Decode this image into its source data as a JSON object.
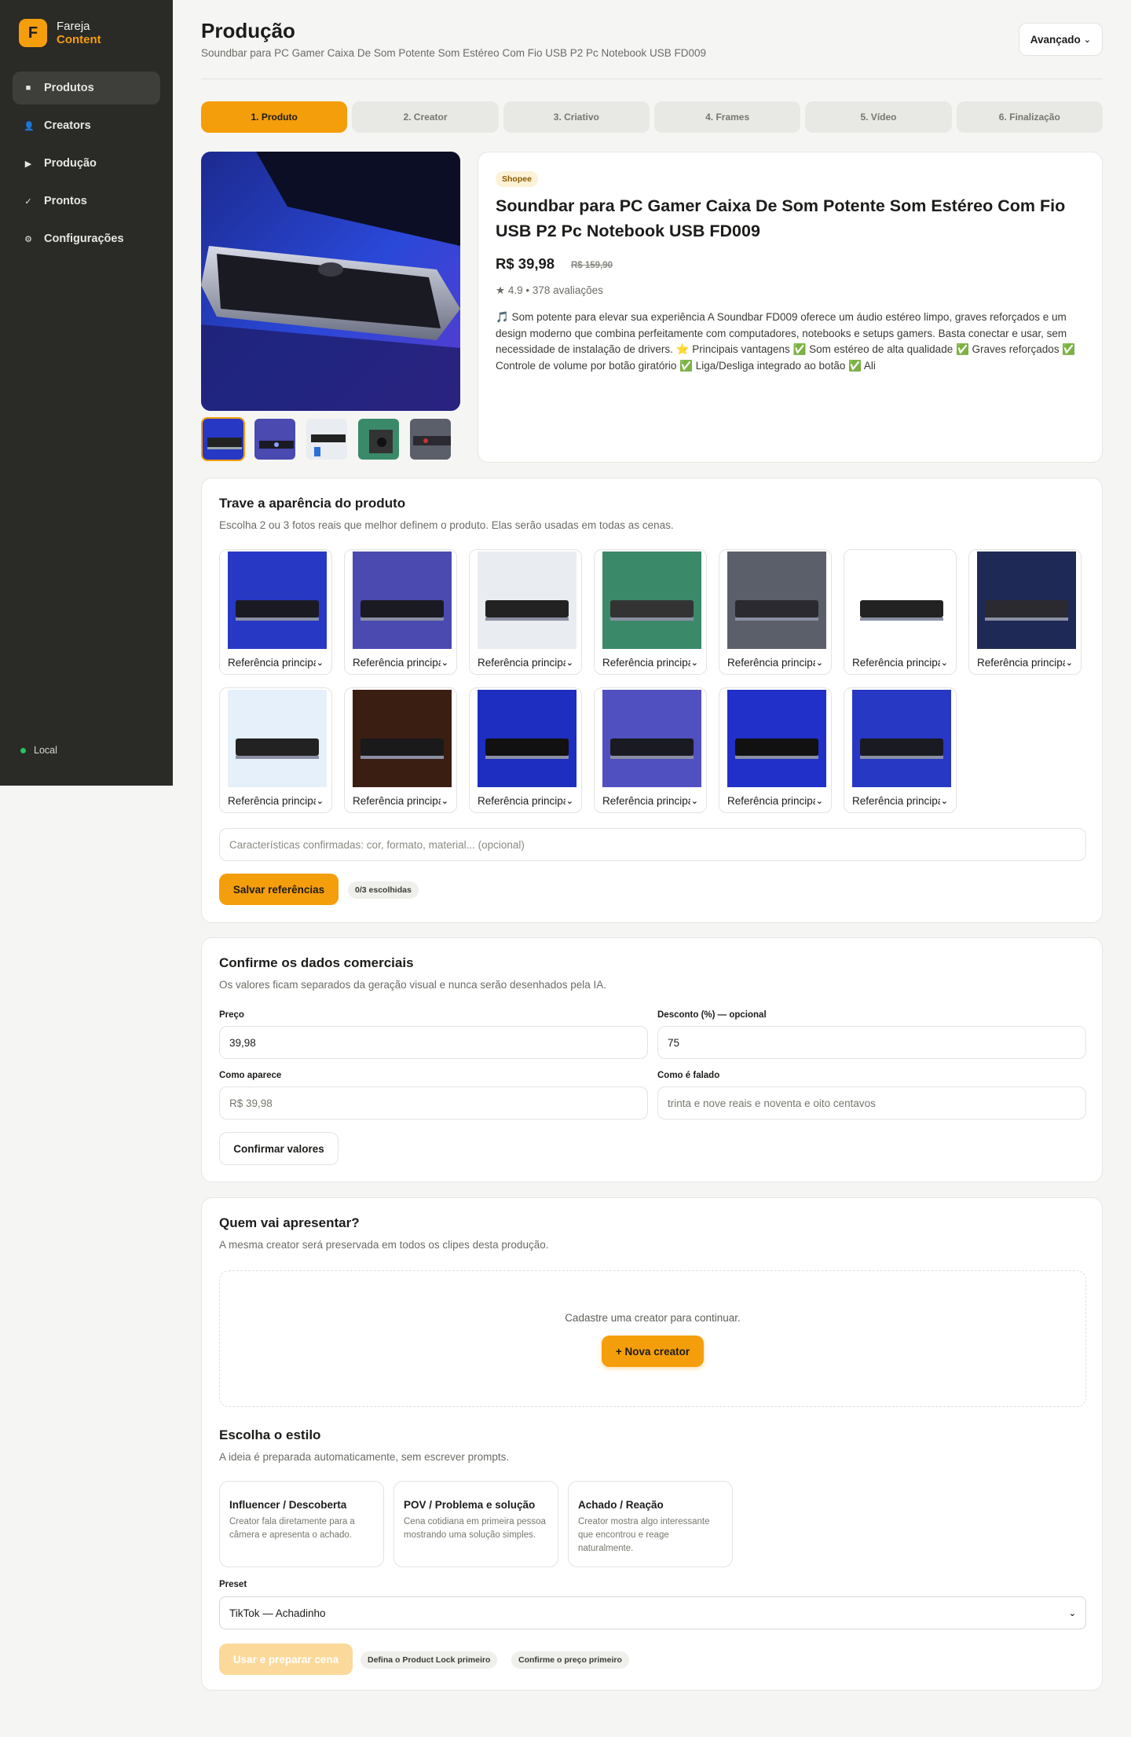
{
  "sidebar": {
    "brand_initial": "F",
    "brand_line1": "Fareja",
    "brand_line2": "Content",
    "items": [
      {
        "label": "Produtos",
        "icon": "square-icon"
      },
      {
        "label": "Creators",
        "icon": "person-icon"
      },
      {
        "label": "Produção",
        "icon": "play-icon"
      },
      {
        "label": "Prontos",
        "icon": "check-icon"
      },
      {
        "label": "Configurações",
        "icon": "gear-icon"
      }
    ],
    "status": "Local"
  },
  "header": {
    "title": "Produção",
    "subtitle": "Soundbar para PC Gamer Caixa De Som Potente Som Estéreo Com Fio USB P2 Pc Notebook USB FD009",
    "advanced_label": "Avançado",
    "advanced_chevron": "⌄"
  },
  "steps": [
    "1. Produto",
    "2. Creator",
    "3. Criativo",
    "4. Frames",
    "5. Vídeo",
    "6. Finalização"
  ],
  "product": {
    "source": "Shopee",
    "title": "Soundbar para PC Gamer Caixa De Som Potente Som Estéreo Com Fio USB P2 Pc Notebook USB FD009",
    "price": "R$ 39,98",
    "old_price": "R$ 159,90",
    "rating": "★ 4.9 • 378 avaliações",
    "description": "🎵 Som potente para elevar sua experiência A Soundbar FD009 oferece um áudio estéreo limpo, graves reforçados e um design moderno que combina perfeitamente com computadores, notebooks e setups gamers. Basta conectar e usar, sem necessidade de instalação de drivers. ⭐ Principais vantagens ✅ Som estéreo de alta qualidade ✅ Graves reforçados ✅ Controle de volume por botão giratório ✅ Liga/Desliga integrado ao botão ✅ Ali"
  },
  "lock": {
    "title": "Trave a aparência do produto",
    "subtitle": "Escolha 2 ou 3 fotos reais que melhor definem o produto. Elas serão usadas em todas as cenas.",
    "ref_label": "Referência principal",
    "ref_count": 13,
    "features_placeholder": "Características confirmadas: cor, formato, material... (opcional)",
    "save_label": "Salvar referências",
    "chosen": "0/3 escolhidas"
  },
  "commercial": {
    "title": "Confirme os dados comerciais",
    "subtitle": "Os valores ficam separados da geração visual e nunca serão desenhados pela IA.",
    "price_label": "Preço",
    "price_value": "39,98",
    "discount_label": "Desconto (%) — opcional",
    "discount_value": "75",
    "display_label": "Como aparece",
    "display_placeholder": "R$ 39,98",
    "spoken_label": "Como é falado",
    "spoken_placeholder": "trinta e nove reais e noventa e oito centavos",
    "confirm_label": "Confirmar valores"
  },
  "creator": {
    "title": "Quem vai apresentar?",
    "subtitle": "A mesma creator será preservada em todos os clipes desta produção.",
    "empty_text": "Cadastre uma creator para continuar.",
    "new_label": "+ Nova creator"
  },
  "style": {
    "title": "Escolha o estilo",
    "subtitle": "A ideia é preparada automaticamente, sem escrever prompts.",
    "cards": [
      {
        "title": "Influencer / Descoberta",
        "desc": "Creator fala diretamente para a câmera e apresenta o achado."
      },
      {
        "title": "POV / Problema e solução",
        "desc": "Cena cotidiana em primeira pessoa mostrando uma solução simples."
      },
      {
        "title": "Achado / Reação",
        "desc": "Creator mostra algo interessante que encontrou e reage naturalmente."
      }
    ],
    "preset_label": "Preset",
    "preset_value": "TikTok — Achadinho",
    "use_label": "Usar e preparar cena",
    "hint1": "Defina o Product Lock primeiro",
    "hint2": "Confirme o preço primeiro"
  },
  "colors": {
    "accent": "#f59e0b",
    "sidebar": "#2a2a27",
    "background": "#f5f5f4"
  }
}
